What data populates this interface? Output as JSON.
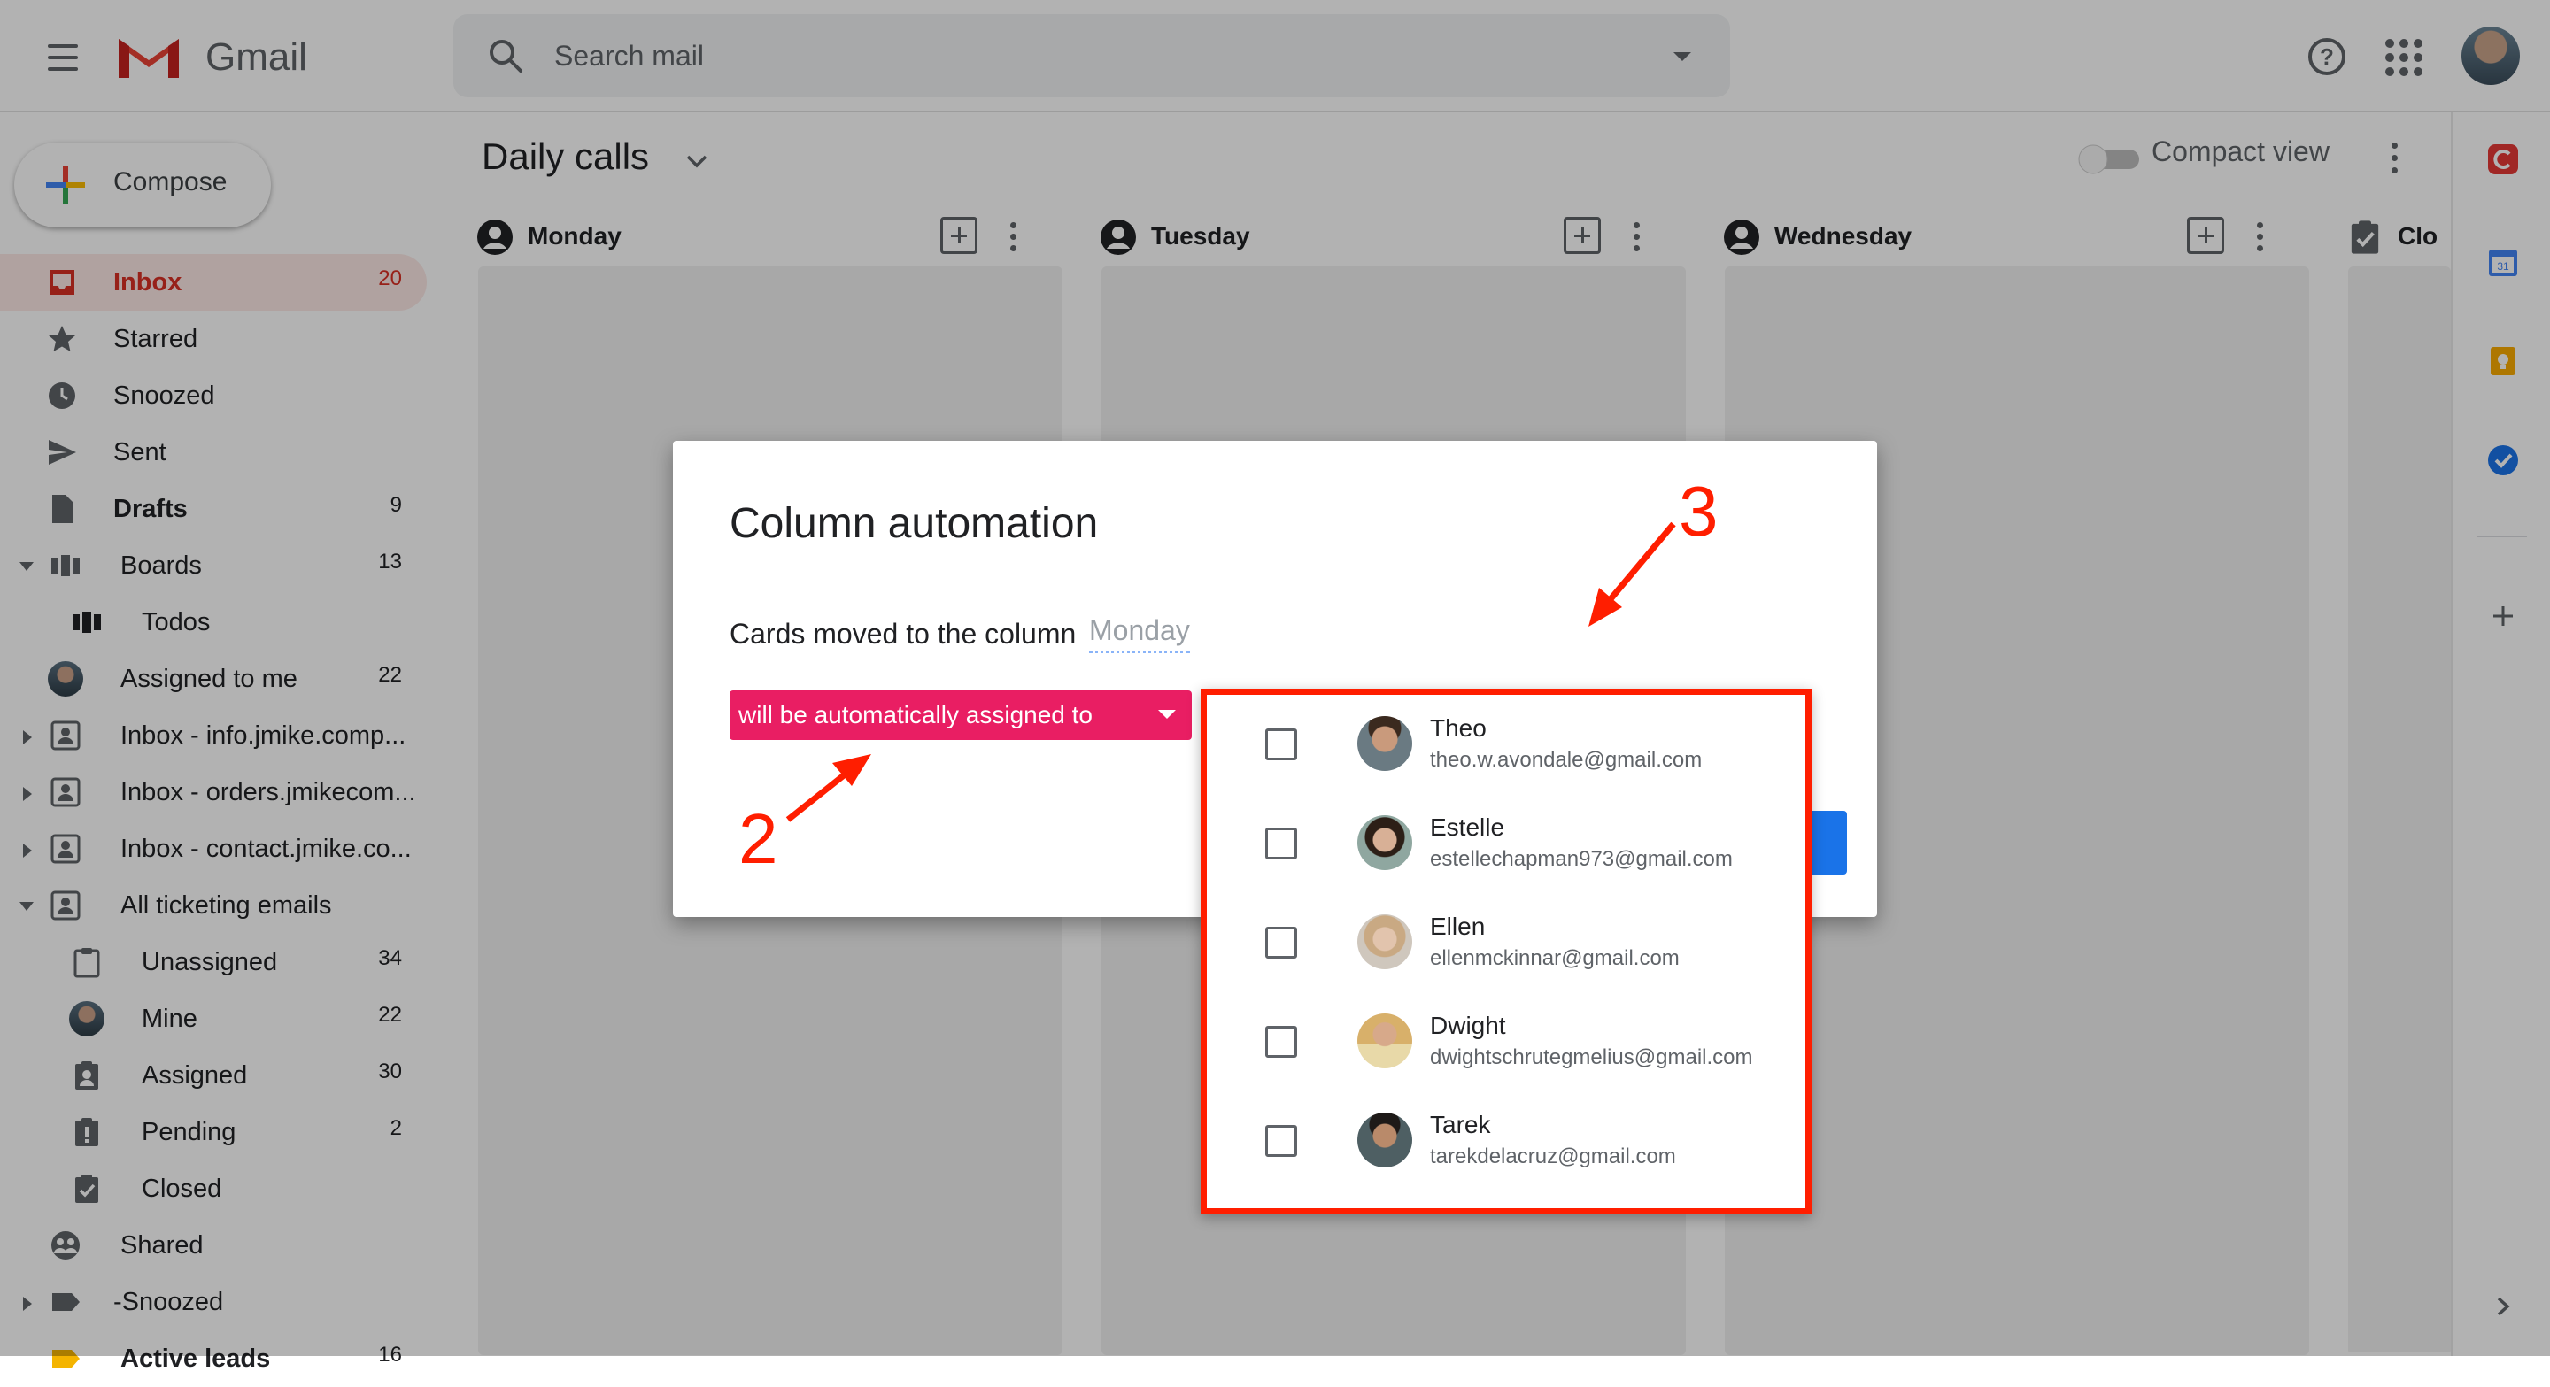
{
  "header": {
    "app_name": "Gmail",
    "search_placeholder": "Search mail"
  },
  "sidebar": {
    "compose_label": "Compose",
    "items": [
      {
        "label": "Inbox",
        "count": "20",
        "icon": "inbox-icon"
      },
      {
        "label": "Starred",
        "count": "",
        "icon": "star-icon"
      },
      {
        "label": "Snoozed",
        "count": "",
        "icon": "clock-icon"
      },
      {
        "label": "Sent",
        "count": "",
        "icon": "send-icon"
      },
      {
        "label": "Drafts",
        "count": "9",
        "icon": "draft-icon"
      },
      {
        "label": "Boards",
        "count": "13",
        "icon": "board-icon"
      },
      {
        "label": "Todos",
        "count": "",
        "icon": "board-icon"
      },
      {
        "label": "Assigned to me",
        "count": "22",
        "icon": "avatar"
      },
      {
        "label": "Inbox - info.jmike.comp...",
        "count": "",
        "icon": "shared-inbox-icon"
      },
      {
        "label": "Inbox - orders.jmikecom...",
        "count": "",
        "icon": "shared-inbox-icon"
      },
      {
        "label": "Inbox - contact.jmike.co...",
        "count": "",
        "icon": "shared-inbox-icon"
      },
      {
        "label": "All ticketing emails",
        "count": "",
        "icon": "shared-inbox-icon"
      },
      {
        "label": "Unassigned",
        "count": "34",
        "icon": "clipboard-icon"
      },
      {
        "label": "Mine",
        "count": "22",
        "icon": "avatar"
      },
      {
        "label": "Assigned",
        "count": "30",
        "icon": "assigned-icon"
      },
      {
        "label": "Pending",
        "count": "2",
        "icon": "pending-icon"
      },
      {
        "label": "Closed",
        "count": "",
        "icon": "closed-icon"
      },
      {
        "label": "Shared",
        "count": "",
        "icon": "shared-icon"
      },
      {
        "label": "-Snoozed",
        "count": "",
        "icon": "label-icon"
      },
      {
        "label": "Active leads",
        "count": "16",
        "icon": "label-icon"
      }
    ]
  },
  "board": {
    "title": "Daily calls",
    "compact_view_label": "Compact view",
    "columns": [
      {
        "title": "Monday"
      },
      {
        "title": "Tuesday"
      },
      {
        "title": "Wednesday"
      },
      {
        "title": "Clo"
      }
    ]
  },
  "dialog": {
    "title": "Column automation",
    "cards_text": "Cards moved to the column",
    "column_value": "Monday",
    "action_label": "will be automatically assigned to"
  },
  "picker": {
    "users": [
      {
        "name": "Theo",
        "email": "theo.w.avondale@gmail.com",
        "checked": false
      },
      {
        "name": "Estelle",
        "email": "estellechapman973@gmail.com",
        "checked": false
      },
      {
        "name": "Ellen",
        "email": "ellenmckinnar@gmail.com",
        "checked": false
      },
      {
        "name": "Dwight",
        "email": "dwightschrutegmelius@gmail.com",
        "checked": false
      },
      {
        "name": "Tarek",
        "email": "tarekdelacruz@gmail.com",
        "checked": false
      }
    ]
  },
  "annotations": {
    "step2": "2",
    "step3": "3"
  },
  "colors": {
    "accent_red": "#ff1e00",
    "action_pink": "#e91e63",
    "inbox_red": "#d93025"
  }
}
